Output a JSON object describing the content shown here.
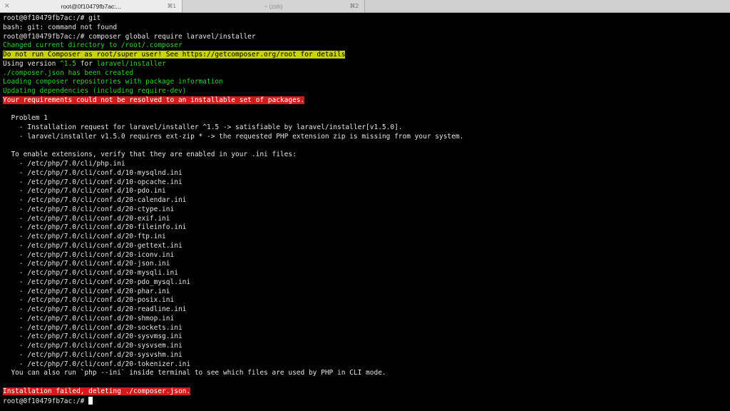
{
  "tabs": [
    {
      "title": "root@0f10479fb7ac:...",
      "shortcut": "⌘1",
      "close": "✕"
    },
    {
      "title": "~ (zsh)",
      "shortcut": "⌘2"
    }
  ],
  "terminal": {
    "lines": [
      {
        "text": "root@0f10479fb7ac:/# git",
        "style": "normal"
      },
      {
        "text": "bash: git: command not found",
        "style": "normal"
      },
      {
        "text": "root@0f10479fb7ac:/# composer global require laravel/installer",
        "style": "normal"
      },
      {
        "text": "Changed current directory to /root/.composer",
        "style": "green"
      },
      {
        "text": "Do not run Composer as root/super user! See https://getcomposer.org/root for details",
        "style": "hl-yellow"
      },
      {
        "text": "Using version ^1.5 for laravel/installer",
        "style": "using"
      },
      {
        "text": "./composer.json has been created",
        "style": "green"
      },
      {
        "text": "Loading composer repositories with package information",
        "style": "green"
      },
      {
        "text": "Updating dependencies (including require-dev)",
        "style": "green"
      },
      {
        "text": "Your requirements could not be resolved to an installable set of packages.",
        "style": "hl-red"
      },
      {
        "text": "",
        "style": "normal"
      },
      {
        "text": "  Problem 1",
        "style": "normal"
      },
      {
        "text": "    - Installation request for laravel/installer ^1.5 -> satisfiable by laravel/installer[v1.5.0].",
        "style": "normal"
      },
      {
        "text": "    - laravel/installer v1.5.0 requires ext-zip * -> the requested PHP extension zip is missing from your system.",
        "style": "normal"
      },
      {
        "text": "",
        "style": "normal"
      },
      {
        "text": "  To enable extensions, verify that they are enabled in your .ini files:",
        "style": "normal"
      },
      {
        "text": "    - /etc/php/7.0/cli/php.ini",
        "style": "normal"
      },
      {
        "text": "    - /etc/php/7.0/cli/conf.d/10-mysqlnd.ini",
        "style": "normal"
      },
      {
        "text": "    - /etc/php/7.0/cli/conf.d/10-opcache.ini",
        "style": "normal"
      },
      {
        "text": "    - /etc/php/7.0/cli/conf.d/10-pdo.ini",
        "style": "normal"
      },
      {
        "text": "    - /etc/php/7.0/cli/conf.d/20-calendar.ini",
        "style": "normal"
      },
      {
        "text": "    - /etc/php/7.0/cli/conf.d/20-ctype.ini",
        "style": "normal"
      },
      {
        "text": "    - /etc/php/7.0/cli/conf.d/20-exif.ini",
        "style": "normal"
      },
      {
        "text": "    - /etc/php/7.0/cli/conf.d/20-fileinfo.ini",
        "style": "normal"
      },
      {
        "text": "    - /etc/php/7.0/cli/conf.d/20-ftp.ini",
        "style": "normal"
      },
      {
        "text": "    - /etc/php/7.0/cli/conf.d/20-gettext.ini",
        "style": "normal"
      },
      {
        "text": "    - /etc/php/7.0/cli/conf.d/20-iconv.ini",
        "style": "normal"
      },
      {
        "text": "    - /etc/php/7.0/cli/conf.d/20-json.ini",
        "style": "normal"
      },
      {
        "text": "    - /etc/php/7.0/cli/conf.d/20-mysqli.ini",
        "style": "normal"
      },
      {
        "text": "    - /etc/php/7.0/cli/conf.d/20-pdo_mysql.ini",
        "style": "normal"
      },
      {
        "text": "    - /etc/php/7.0/cli/conf.d/20-phar.ini",
        "style": "normal"
      },
      {
        "text": "    - /etc/php/7.0/cli/conf.d/20-posix.ini",
        "style": "normal"
      },
      {
        "text": "    - /etc/php/7.0/cli/conf.d/20-readline.ini",
        "style": "normal"
      },
      {
        "text": "    - /etc/php/7.0/cli/conf.d/20-shmop.ini",
        "style": "normal"
      },
      {
        "text": "    - /etc/php/7.0/cli/conf.d/20-sockets.ini",
        "style": "normal"
      },
      {
        "text": "    - /etc/php/7.0/cli/conf.d/20-sysvmsg.ini",
        "style": "normal"
      },
      {
        "text": "    - /etc/php/7.0/cli/conf.d/20-sysvsem.ini",
        "style": "normal"
      },
      {
        "text": "    - /etc/php/7.0/cli/conf.d/20-sysvshm.ini",
        "style": "normal"
      },
      {
        "text": "    - /etc/php/7.0/cli/conf.d/20-tokenizer.ini",
        "style": "normal"
      },
      {
        "text": "  You can also run `php --ini` inside terminal to see which files are used by PHP in CLI mode.",
        "style": "normal"
      },
      {
        "text": "",
        "style": "normal"
      },
      {
        "text": "Installation failed, deleting ./composer.json.",
        "style": "hl-red"
      },
      {
        "text": "root@0f10479fb7ac:/# ",
        "style": "prompt"
      }
    ]
  }
}
